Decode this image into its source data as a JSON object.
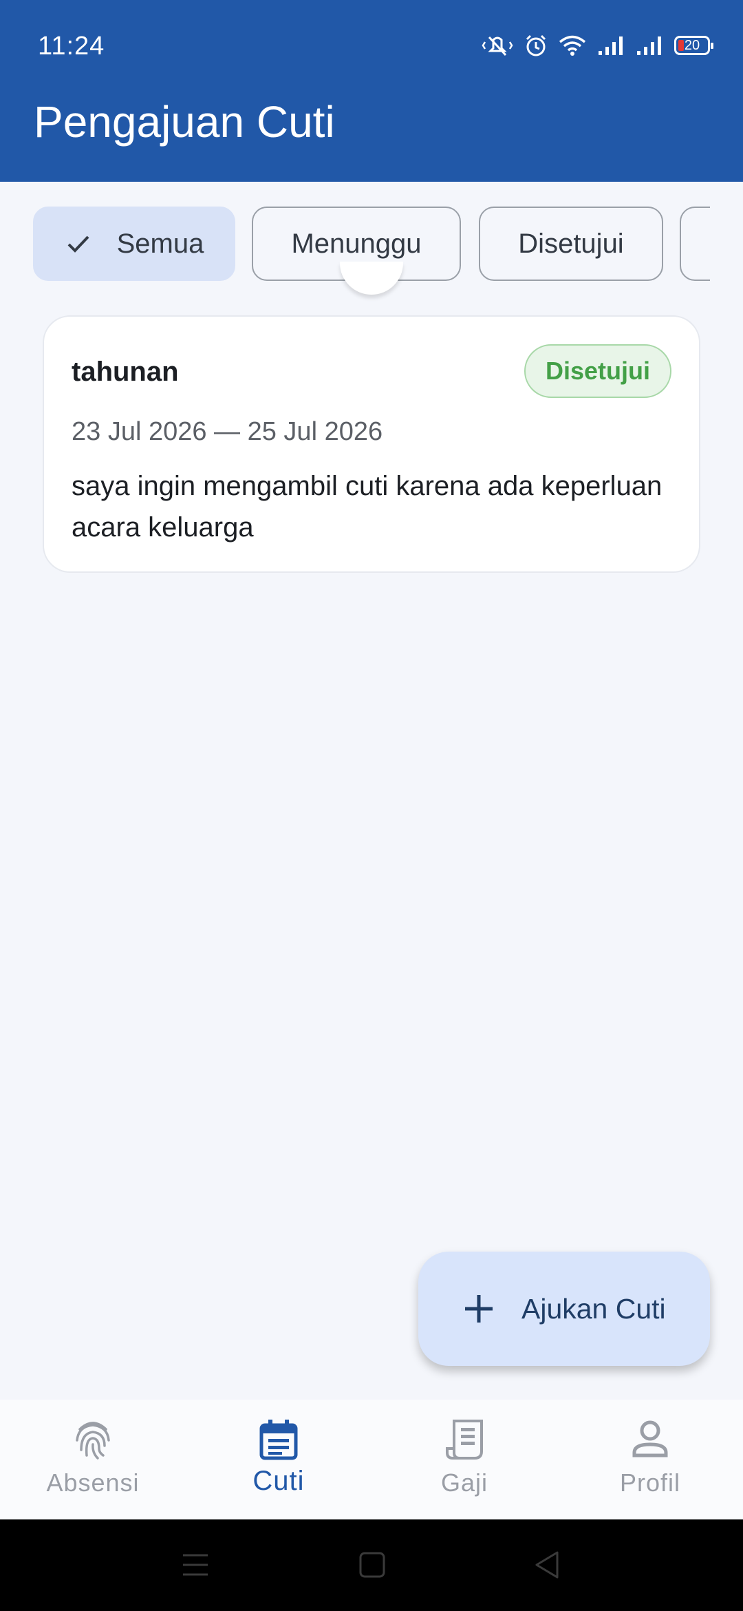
{
  "status_bar": {
    "time": "11:24",
    "battery": "20",
    "icons": [
      "vibrate-icon",
      "alarm-icon",
      "wifi-icon",
      "signal-icon",
      "signal-icon",
      "battery-icon"
    ]
  },
  "app_bar": {
    "title": "Pengajuan Cuti"
  },
  "filters": [
    {
      "label": "Semua",
      "selected": true
    },
    {
      "label": "Menunggu",
      "selected": false
    },
    {
      "label": "Disetujui",
      "selected": false
    }
  ],
  "leave_requests": [
    {
      "type": "tahunan",
      "status": "Disetujui",
      "date_range": "23 Jul 2026 — 25 Jul 2026",
      "description": "saya ingin mengambil cuti karena ada keperluan acara keluarga"
    }
  ],
  "fab": {
    "label": "Ajukan Cuti",
    "icon": "plus-icon"
  },
  "bottom_nav": [
    {
      "label": "Absensi",
      "icon": "fingerprint-icon",
      "active": false
    },
    {
      "label": "Cuti",
      "icon": "calendar-icon",
      "active": true
    },
    {
      "label": "Gaji",
      "icon": "receipt-icon",
      "active": false
    },
    {
      "label": "Profil",
      "icon": "person-icon",
      "active": false
    }
  ],
  "colors": {
    "primary": "#2158a8",
    "chip_selected": "#d8e2f7",
    "approved_text": "#43a047",
    "approved_bg": "#e8f5e8",
    "fab_bg": "#d8e4fb",
    "background": "#f4f6fb"
  }
}
